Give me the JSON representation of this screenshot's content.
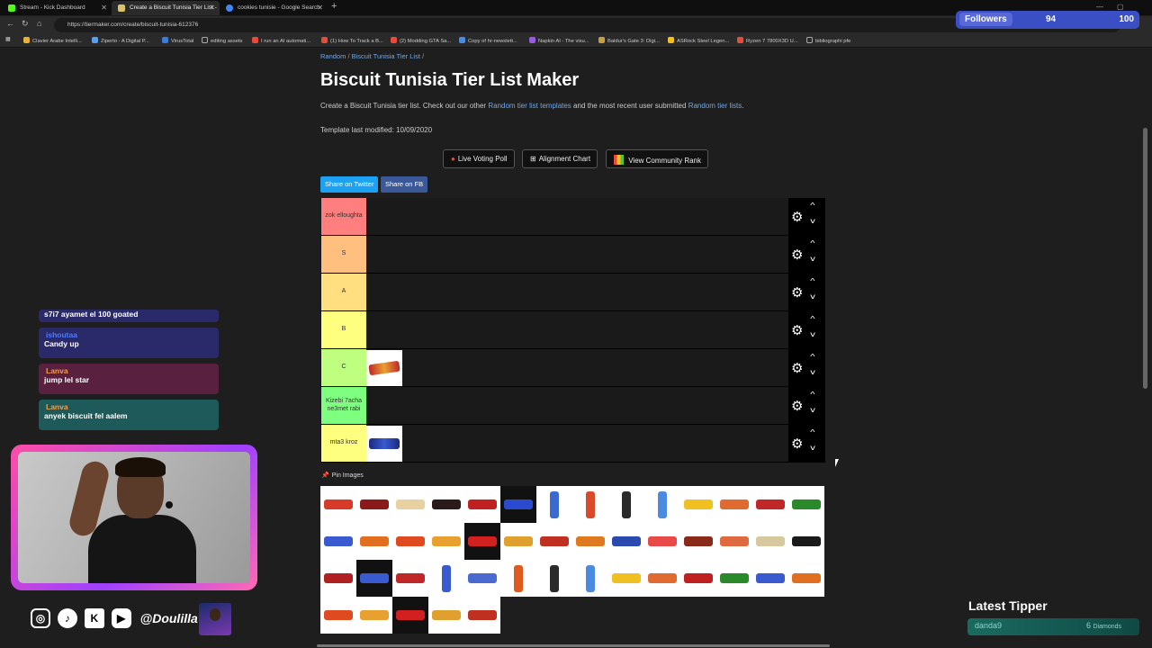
{
  "browser": {
    "tabs": [
      {
        "title": "Stream - Kick Dashboard",
        "favicon_color": "#53fc18",
        "active": false
      },
      {
        "title": "Create a Biscuit Tunisia Tier List -",
        "favicon_color": "#d9c26a",
        "active": true
      },
      {
        "title": "cookies tunisie - Google Search",
        "favicon_color": "#4285f4",
        "active": false
      }
    ],
    "new_tab": "+",
    "url": "https://tiermaker.com/create/biscuit-tunisia-612376",
    "bookmarks": [
      {
        "label": "Clavier Arabe Intelli...",
        "color": "#e8b23a"
      },
      {
        "label": "Ziperto - A Digital P...",
        "color": "#5aa0e8"
      },
      {
        "label": "VirusTotal",
        "color": "#3d7bd9"
      },
      {
        "label": "editing assets",
        "color": "#888888"
      },
      {
        "label": "I run an AI automati...",
        "color": "#e84b3c"
      },
      {
        "label": "(1) How To Track a B...",
        "color": "#e84b3c"
      },
      {
        "label": "(2) Modding GTA Sa...",
        "color": "#e84b3c"
      },
      {
        "label": "Copy of hr-newslett...",
        "color": "#4a8be0"
      },
      {
        "label": "Napkin AI - The visu...",
        "color": "#9a5ae0"
      },
      {
        "label": "Baldur's Gate 3: Digi...",
        "color": "#c9a040"
      },
      {
        "label": "ASRock Steel Legen...",
        "color": "#f0c020"
      },
      {
        "label": "Ryzen 7 7800X3D U...",
        "color": "#e84b3c"
      },
      {
        "label": "bibliographi pfe",
        "color": "#888888"
      }
    ]
  },
  "overlay": {
    "followers_label": "Followers",
    "followers_count": "94",
    "followers_goal": "100",
    "chat": [
      {
        "user": "",
        "message": "s7i7 ayamet el 100 goated",
        "user_color": "#fff",
        "bg": "#2a2a6a"
      },
      {
        "user": "ishoutaa",
        "message": "Candy up",
        "user_color": "#4a7bff",
        "bg": "#2a2a6a"
      },
      {
        "user": "Lanva",
        "message": "jump lel star",
        "user_color": "#ff9a3a",
        "bg": "#5a2040"
      },
      {
        "user": "Lanva",
        "message": "anyek biscuit fel aalem",
        "user_color": "#ff9a3a",
        "bg": "#1e5a5a"
      }
    ],
    "social_handle": "@Doulilla",
    "social_icons": [
      "instagram-icon",
      "tiktok-icon",
      "kick-icon",
      "youtube-icon"
    ],
    "tipper_title": "Latest Tipper",
    "tipper_name": "danda9",
    "tipper_amount": "6",
    "tipper_unit": "Diamonds"
  },
  "page": {
    "breadcrumb": [
      "Random",
      "Biscuit Tunisia Tier List"
    ],
    "title": "Biscuit Tunisia Tier List Maker",
    "desc_prefix": "Create a Biscuit Tunisia tier list. Check out our other",
    "desc_link1": "Random tier list templates",
    "desc_middle": "and the most recent user submitted",
    "desc_link2": "Random tier lists",
    "desc_suffix": ".",
    "modified": "Template last modified: 10/09/2020",
    "buttons": {
      "voting": "Live Voting Poll",
      "alignment": "Alignment Chart",
      "community": "View Community Rank"
    },
    "share_twitter": "Share on Twitter",
    "share_fb": "Share on FB",
    "pin_images": "Pin Images"
  },
  "tiers": [
    {
      "label": "zok elloughta",
      "color": "#ff7f7f",
      "items": []
    },
    {
      "label": "S",
      "color": "#ffbf7f",
      "items": []
    },
    {
      "label": "A",
      "color": "#ffdf7f",
      "items": []
    },
    {
      "label": "B",
      "color": "#ffff7f",
      "items": []
    },
    {
      "label": "C",
      "color": "#bfff7f",
      "items": [
        "biscuit-red"
      ]
    },
    {
      "label": "Kizebi 7acha ne3met rabi",
      "color": "#7fff7f",
      "items": []
    },
    {
      "label": "mta3 kroz",
      "color": "#ffff7f",
      "items": [
        "biscuit-blue"
      ]
    }
  ],
  "colors": {
    "link": "#6fa8e8",
    "twitter": "#1da1f2",
    "facebook": "#3b5998",
    "followers_bar": "#3b4fc4"
  }
}
